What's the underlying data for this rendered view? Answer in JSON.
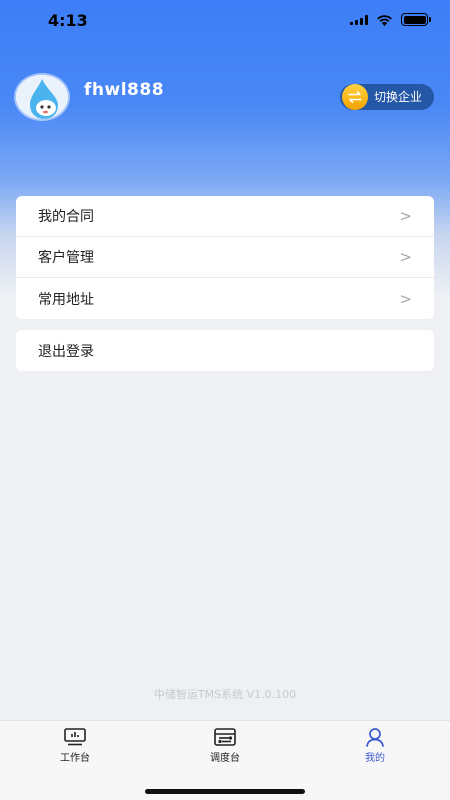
{
  "status_bar": {
    "time": "4:13"
  },
  "profile": {
    "username": "fhwl888"
  },
  "switch_company": {
    "label": "切换企业"
  },
  "menu": {
    "items": [
      {
        "label": "我的合同"
      },
      {
        "label": "客户管理"
      },
      {
        "label": "常用地址"
      }
    ],
    "chevron": ">"
  },
  "logout": {
    "label": "退出登录"
  },
  "footer": {
    "version": "中储智运TMS系统 V1.0.100"
  },
  "tabbar": {
    "tabs": [
      {
        "label": "工作台",
        "icon": "monitor-icon",
        "active": false
      },
      {
        "label": "调度台",
        "icon": "dispatch-icon",
        "active": false
      },
      {
        "label": "我的",
        "icon": "person-icon",
        "active": true
      }
    ]
  },
  "colors": {
    "accent": "#3d7ef7",
    "active_tab": "#3b5bcf",
    "switch_bg": "#2457a6"
  }
}
